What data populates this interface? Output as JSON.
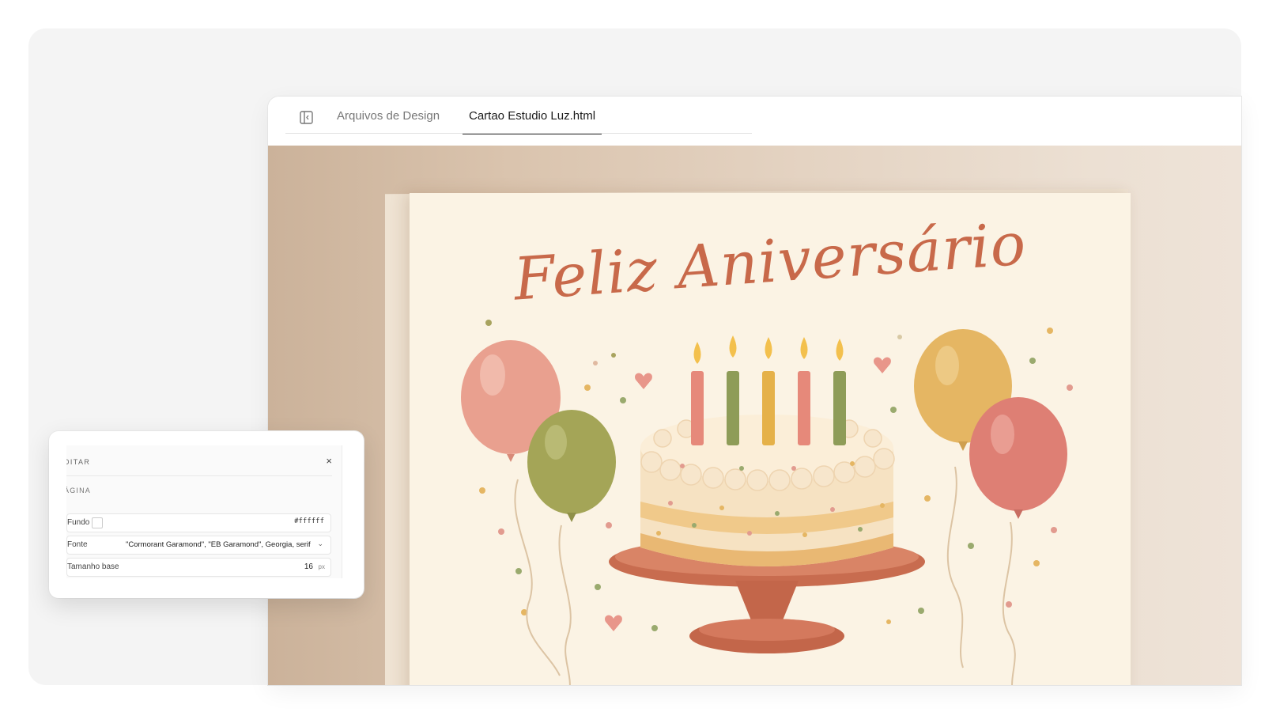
{
  "tabs": {
    "design_files": "Arquivos de Design",
    "active_file": "Cartao Estudio Luz.html"
  },
  "card": {
    "title": "Feliz Aniversário"
  },
  "panel": {
    "title": "DITAR",
    "close": "×",
    "section": "ÁGINA",
    "background_label": "Fundo",
    "background_value": "#ffffff",
    "font_label": "Fonte",
    "font_value": "\"Cormorant Garamond\", \"EB Garamond\", Georgia, serif",
    "base_size_label": "Tamanho base",
    "base_size_value": "16",
    "base_size_unit": "px"
  },
  "colors": {
    "title": "#c8694a",
    "pink_balloon": "#e9a08f",
    "olive_balloon": "#a4a557",
    "yellow_balloon": "#e5b663",
    "coral_balloon": "#de7f74",
    "cake_stand": "#c86c4f"
  }
}
